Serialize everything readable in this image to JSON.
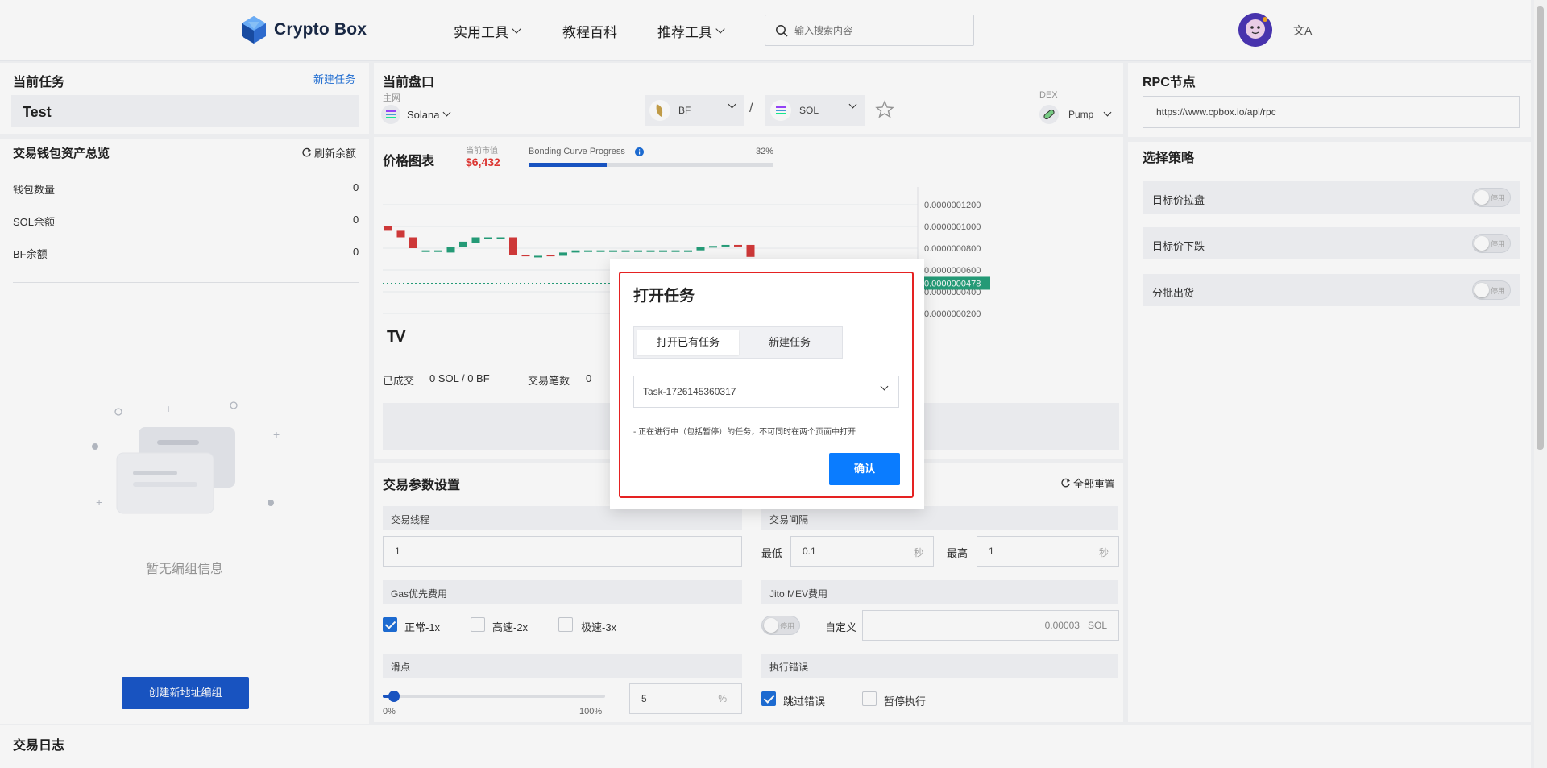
{
  "header": {
    "logo_text": "Crypto Box",
    "nav": [
      {
        "label": "实用工具",
        "dropdown": true
      },
      {
        "label": "教程百科",
        "dropdown": false
      },
      {
        "label": "推荐工具",
        "dropdown": true
      }
    ],
    "search_placeholder": "输入搜索内容",
    "lang_icon": "文A"
  },
  "left": {
    "task_title": "当前任务",
    "new_task_link": "新建任务",
    "task_name": "Test",
    "wallet_title": "交易钱包资产总览",
    "refresh_label": "刷新余额",
    "rows": [
      {
        "label": "钱包数量",
        "value": "0"
      },
      {
        "label": "SOL余额",
        "value": "0"
      },
      {
        "label": "BF余额",
        "value": "0"
      }
    ],
    "empty_text": "暂无编组信息",
    "create_group_button": "创建新地址编组",
    "log_title": "交易日志"
  },
  "market": {
    "title": "当前盘口",
    "network_label": "主网",
    "network": "Solana",
    "token_a": "BF",
    "separator": "/",
    "token_b": "SOL",
    "dex_label": "DEX",
    "dex": "Pump",
    "chart_title": "价格图表",
    "market_cap_label": "当前市值",
    "market_cap": "$6,432",
    "bonding_label": "Bonding Curve Progress",
    "bonding_pct_text": "32%",
    "bonding_progress": 0.32,
    "y_ticks": [
      "0.0000001200",
      "0.0000001000",
      "0.0000000800",
      "0.0000000600",
      "0.0000000400",
      "0.0000000200"
    ],
    "current_price": "0.0000000478",
    "traded_label": "已成交",
    "traded_value": "0 SOL / 0 BF",
    "count_label": "交易笔数",
    "count_value": "0"
  },
  "params": {
    "title": "交易参数设置",
    "reset_label": "全部重置",
    "threads_label": "交易线程",
    "threads_value": "1",
    "interval_label": "交易间隔",
    "min_label": "最低",
    "min_value": "0.1",
    "max_label": "最高",
    "max_value": "1",
    "sec_unit": "秒",
    "gas_label": "Gas优先费用",
    "gas_options": [
      "正常-1x",
      "高速-2x",
      "极速-3x"
    ],
    "jito_label": "Jito MEV费用",
    "custom_label": "自定义",
    "jito_value": "0.00003",
    "jito_unit": "SOL",
    "slippage_label": "滑点",
    "slip_min": "0%",
    "slip_max": "100%",
    "slip_value": "5",
    "slip_unit": "%",
    "error_label": "执行错误",
    "skip_error": "跳过错误",
    "pause_exec": "暂停执行",
    "toggle_off": "停用"
  },
  "right": {
    "rpc_title": "RPC节点",
    "rpc_value": "https://www.cpbox.io/api/rpc",
    "strategy_title": "选择策略",
    "strategies": [
      "目标价拉盘",
      "目标价下跌",
      "分批出货"
    ]
  },
  "modal": {
    "title": "打开任务",
    "tabs": [
      "打开已有任务",
      "新建任务"
    ],
    "selected_task": "Task-1726145360317",
    "note": "- 正在进行中（包括暂停）的任务，不可同时在两个页面中打开",
    "confirm": "确认"
  },
  "chart_data": {
    "type": "candlestick",
    "y_ticks": [
      "0.0000001200",
      "0.0000001000",
      "0.0000000800",
      "0.0000000600",
      "0.0000000400",
      "0.0000000200"
    ],
    "current_price": "0.0000000478",
    "colors": {
      "up": "#26a17b",
      "down": "#d63b3b"
    }
  }
}
